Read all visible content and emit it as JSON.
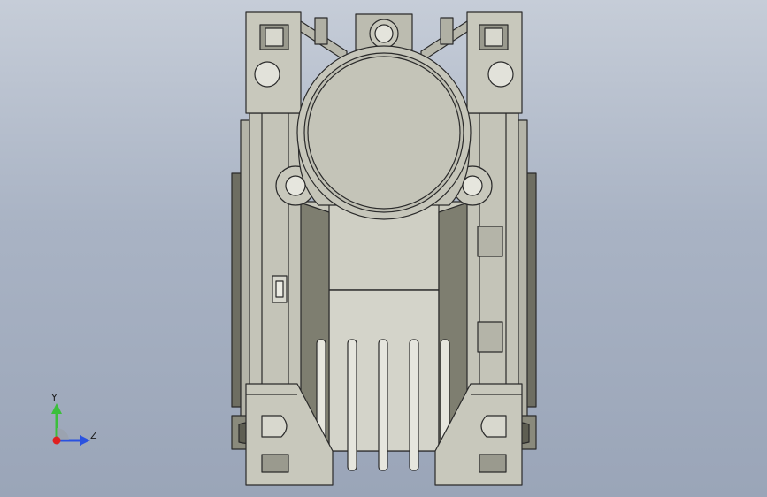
{
  "viewport": {
    "background_top": "#c6cdd8",
    "background_bottom": "#9aa5b8"
  },
  "model": {
    "name": "worm-gear-reducer-housing",
    "body_color": "#c4c4b8",
    "shadow_color": "#8a8a7c",
    "edge_color": "#2a2a2a"
  },
  "triad": {
    "y_label": "Y",
    "z_label": "Z",
    "y_color": "#3bbf3b",
    "z_color": "#2a52e0",
    "x_color": "#e02020"
  }
}
